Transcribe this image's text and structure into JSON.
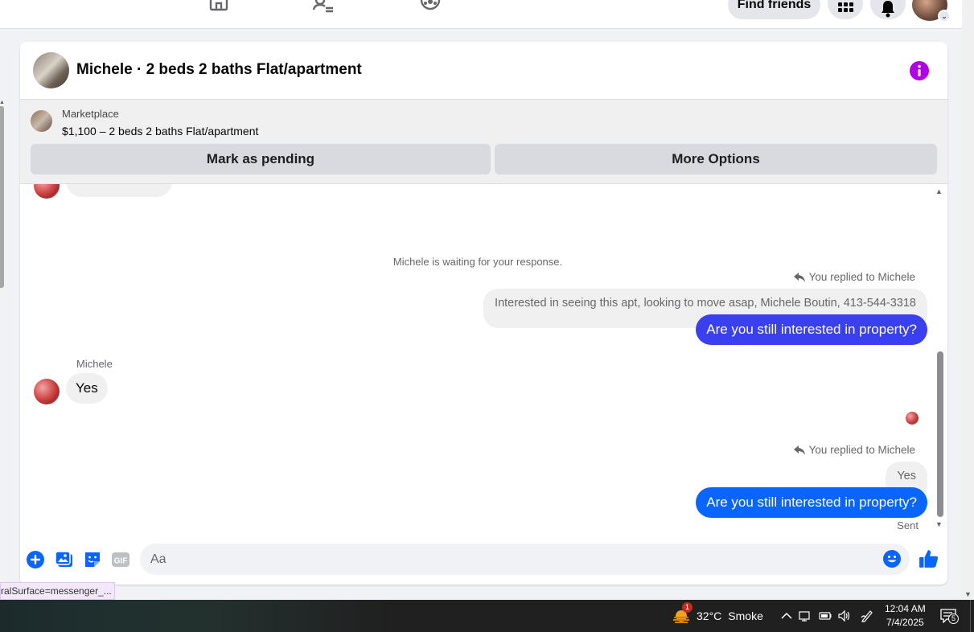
{
  "topbar": {
    "find_friends": "Find friends"
  },
  "chat": {
    "title": "Michele · 2 beds 2 baths Flat/apartment",
    "marketplace": {
      "label": "Marketplace",
      "listing": "$1,100 – 2 beds 2 baths Flat/apartment",
      "mark_pending": "Mark as pending",
      "more_options": "More Options"
    },
    "messages": {
      "waiting": "Michele is waiting for your response.",
      "reply1": {
        "replied_label": "You replied to Michele",
        "quoted": "Interested in seeing this apt, looking to move asap, Michele Boutin,  413-544-3318",
        "text": "Are you still interested in property?"
      },
      "incoming": {
        "sender": "Michele",
        "text": "Yes"
      },
      "reply2": {
        "replied_label": "You replied to Michele",
        "quoted": "Yes",
        "text": "Are you still interested in property?"
      },
      "status": "Sent"
    },
    "composer": {
      "placeholder": "Aa"
    }
  },
  "status_url": "ralSurface=messenger_...",
  "taskbar": {
    "weather_badge": "1",
    "weather_temp": "32°C",
    "weather_desc": "Smoke",
    "time": "12:04 AM",
    "date": "7/4/2025",
    "notification_count": "5"
  },
  "colors": {
    "accent_blue": "#0866ff",
    "purple_bubble": "#3a3ff0",
    "info_purple": "#b100e8"
  }
}
